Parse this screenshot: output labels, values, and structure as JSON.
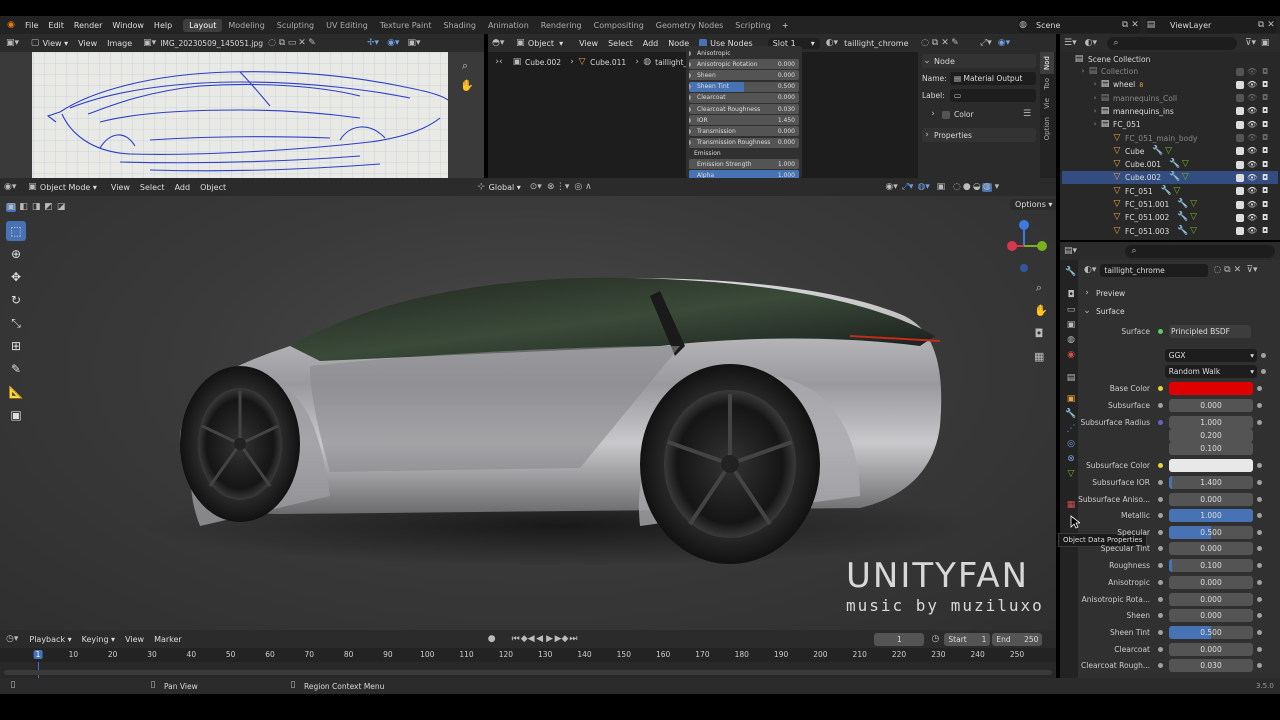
{
  "menubar": {
    "items": [
      "File",
      "Edit",
      "Render",
      "Window",
      "Help"
    ],
    "workspaces": [
      "Layout",
      "Modeling",
      "Sculpting",
      "UV Editing",
      "Texture Paint",
      "Shading",
      "Animation",
      "Rendering",
      "Compositing",
      "Geometry Nodes",
      "Scripting"
    ],
    "add_tab": "+",
    "scene": "Scene",
    "view_layer": "ViewLayer"
  },
  "image_editor": {
    "view": "View",
    "view2": "View",
    "image": "Image",
    "filename": "IMG_20230509_145051.jpg"
  },
  "node_editor": {
    "object_mode": "Object",
    "view": "View",
    "select": "Select",
    "add": "Add",
    "node": "Node",
    "use_nodes": "Use Nodes",
    "slot": "Slot 1",
    "material": "taillight_chrome",
    "breadcrumb": [
      "Cube.002",
      "Cube.011",
      "taillight_chrome"
    ],
    "node_rows": [
      {
        "label": "Anisotropic",
        "value": ""
      },
      {
        "label": "Anisotropic Rotation",
        "value": "0.000"
      },
      {
        "label": "Sheen",
        "value": "0.000"
      },
      {
        "label": "Sheen Tint",
        "value": "0.500",
        "fill": 0.5
      },
      {
        "label": "Clearcoat",
        "value": "0.000"
      },
      {
        "label": "Clearcoat Roughness",
        "value": "0.030"
      },
      {
        "label": "IOR",
        "value": "1.450"
      },
      {
        "label": "Transmission",
        "value": "0.000"
      },
      {
        "label": "Transmission Roughness",
        "value": "0.000"
      }
    ],
    "emission_header": "Emission",
    "emission_strength": {
      "label": "Emission Strength",
      "value": "1.000"
    },
    "alpha": {
      "label": "Alpha",
      "value": "1.000"
    },
    "sidebar": {
      "section": "Node",
      "name_label": "Name:",
      "name_value": "Material Output",
      "label_label": "Label:",
      "color_label": "Color",
      "properties_label": "Properties",
      "tabs": [
        "Nod",
        "Too",
        "Vie",
        "Option"
      ]
    }
  },
  "viewport": {
    "mode": "Object Mode",
    "view": "View",
    "select": "Select",
    "add": "Add",
    "object": "Object",
    "orientation": "Global",
    "options": "Options",
    "watermark_title": "UNITYFAN",
    "watermark_sub": "music by muziluxo"
  },
  "outliner": {
    "title": "Scene Collection",
    "rows": [
      {
        "label": "Collection",
        "indent": 0,
        "dim": true,
        "icon": "collection"
      },
      {
        "label": "wheel",
        "indent": 1,
        "icon": "collection",
        "badge": "8"
      },
      {
        "label": "mannequins_Coll",
        "indent": 1,
        "icon": "collection",
        "dim": true
      },
      {
        "label": "mannequins_ins",
        "indent": 1,
        "icon": "collection"
      },
      {
        "label": "FC_051",
        "indent": 1,
        "icon": "collection"
      },
      {
        "label": "FC_051_main_body",
        "indent": 2,
        "icon": "mesh",
        "dim": true
      },
      {
        "label": "Cube",
        "indent": 2,
        "icon": "mesh"
      },
      {
        "label": "Cube.001",
        "indent": 2,
        "icon": "mesh"
      },
      {
        "label": "Cube.002",
        "indent": 2,
        "icon": "mesh",
        "selected": true
      },
      {
        "label": "FC_051",
        "indent": 2,
        "icon": "mesh"
      },
      {
        "label": "FC_051.001",
        "indent": 2,
        "icon": "mesh"
      },
      {
        "label": "FC_051.002",
        "indent": 2,
        "icon": "mesh"
      },
      {
        "label": "FC_051.003",
        "indent": 2,
        "icon": "mesh"
      }
    ]
  },
  "properties": {
    "material": "taillight_chrome",
    "preview": "Preview",
    "surface": "Surface",
    "surface_label": "Surface",
    "surface_shader": "Principled BSDF",
    "distribution": "GGX",
    "subsurface_method": "Random Walk",
    "base_color_label": "Base Color",
    "base_color": "#e00000",
    "rows": [
      {
        "label": "Subsurface",
        "value": "0.000",
        "fill": 0
      },
      {
        "label": "Subsurface Radius",
        "value": "1.000",
        "extra": [
          "0.200",
          "0.100"
        ]
      },
      {
        "label": "Subsurface Color",
        "value": "",
        "color": "#e8e8e8"
      },
      {
        "label": "Subsurface IOR",
        "value": "1.400",
        "fill": 0.04
      },
      {
        "label": "Subsurface Aniso...",
        "value": "0.000",
        "fill": 0
      },
      {
        "label": "Metallic",
        "value": "1.000",
        "fill": 1
      },
      {
        "label": "Specular",
        "value": "0.500",
        "fill": 0.5
      },
      {
        "label": "Specular Tint",
        "value": "0.000",
        "fill": 0
      },
      {
        "label": "Roughness",
        "value": "0.100",
        "fill": 0.03
      },
      {
        "label": "Anisotropic",
        "value": "0.000",
        "fill": 0
      },
      {
        "label": "Anisotropic Rota...",
        "value": "0.000",
        "fill": 0
      },
      {
        "label": "Sheen",
        "value": "0.000",
        "fill": 0
      },
      {
        "label": "Sheen Tint",
        "value": "0.500",
        "fill": 0.5
      },
      {
        "label": "Clearcoat",
        "value": "0.000",
        "fill": 0
      },
      {
        "label": "Clearcoat Rough...",
        "value": "0.030",
        "fill": 0
      }
    ],
    "tooltip": "Object Data Properties"
  },
  "timeline": {
    "playback": "Playback",
    "keying": "Keying",
    "view": "View",
    "marker": "Marker",
    "current_frame": "1",
    "start_label": "Start",
    "start": "1",
    "end_label": "End",
    "end": "250",
    "ticks": [
      "1",
      "10",
      "20",
      "30",
      "40",
      "50",
      "60",
      "70",
      "80",
      "90",
      "100",
      "110",
      "120",
      "130",
      "140",
      "150",
      "160",
      "170",
      "180",
      "190",
      "200",
      "210",
      "220",
      "230",
      "240",
      "250"
    ]
  },
  "statusbar": {
    "left": "Pan View",
    "middle": "Region Context Menu",
    "version": "3.5.0"
  },
  "colors": {
    "accent": "#4772b3",
    "header": "#2b2b2b",
    "panel": "#303030"
  }
}
